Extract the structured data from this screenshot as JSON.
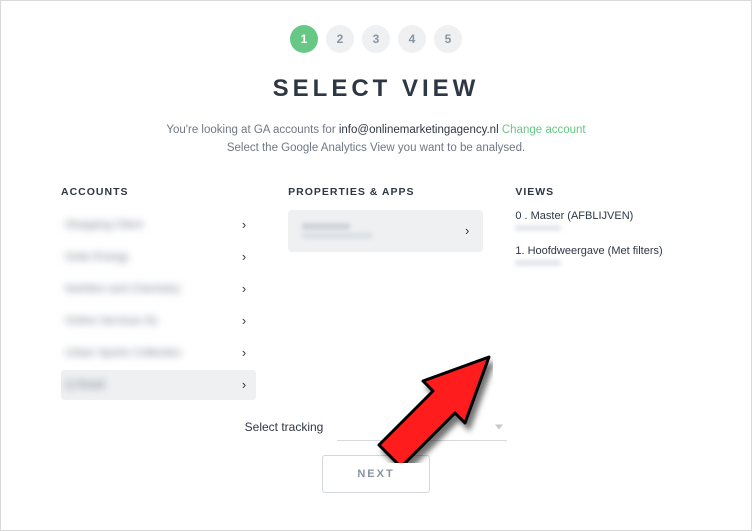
{
  "stepper": {
    "steps": [
      "1",
      "2",
      "3",
      "4",
      "5"
    ],
    "active_index": 0
  },
  "title": "SELECT VIEW",
  "intro": {
    "prefix": "You're looking at GA accounts for ",
    "email": "info@onlinemarketingagency.nl",
    "change": "Change account",
    "line2": "Select the Google Analytics View you want to be analysed."
  },
  "columns": {
    "accounts": {
      "heading": "ACCOUNTS",
      "items": [
        {
          "label": "Shopping Client",
          "obscured": true,
          "selected": false
        },
        {
          "label": "Solar Energy",
          "obscured": true,
          "selected": false
        },
        {
          "label": "Nutrition and Chemistry",
          "obscured": true,
          "selected": false
        },
        {
          "label": "Online Services NL",
          "obscured": true,
          "selected": false
        },
        {
          "label": "Urban Sports Collection",
          "obscured": true,
          "selected": false
        },
        {
          "label": "Q Retail",
          "obscured": true,
          "selected": true
        }
      ]
    },
    "properties": {
      "heading": "PROPERTIES & APPS",
      "items": [
        {
          "label": "Q Retail",
          "obscured": true,
          "selected": true
        }
      ]
    },
    "views": {
      "heading": "VIEWS",
      "items": [
        {
          "label": "0 . Master (AFBLIJVEN)"
        },
        {
          "label": "1. Hoofdweergave (Met filters)"
        }
      ]
    }
  },
  "tracking": {
    "label": "Select tracking",
    "value": ""
  },
  "next_label": "NEXT",
  "icons": {
    "chevron": "›"
  }
}
